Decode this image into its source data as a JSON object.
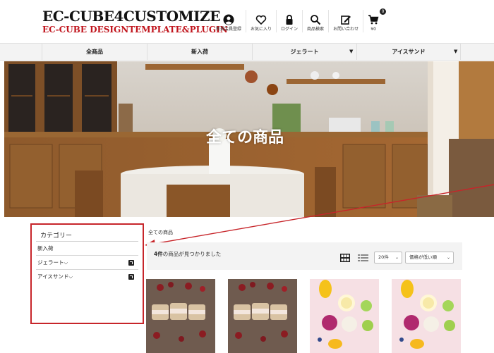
{
  "header": {
    "logo_line1": "EC-CUBE4CUSTOMIZE",
    "logo_line2": "EC-CUBE DESIGNTEMPLATE&PLUGIN",
    "nav": [
      {
        "label": "新規会員登録",
        "icon": "user-icon"
      },
      {
        "label": "お気に入り",
        "icon": "heart-icon"
      },
      {
        "label": "ログイン",
        "icon": "lock-icon"
      },
      {
        "label": "商品検索",
        "icon": "search-icon"
      },
      {
        "label": "お問い合わせ",
        "icon": "edit-icon"
      }
    ],
    "cart": {
      "count": "0",
      "price": "¥0",
      "icon": "cart-icon"
    }
  },
  "catbar": {
    "items": [
      "全商品",
      "新入荷",
      "ジェラート",
      "アイスサンド"
    ]
  },
  "hero": {
    "title": "全ての商品"
  },
  "sidebar": {
    "title": "カテゴリー",
    "items": [
      {
        "label": "新入荷"
      },
      {
        "label": "ジェラート⌵"
      },
      {
        "label": "アイスサンド⌵"
      }
    ]
  },
  "main": {
    "breadcrumb": "全ての商品",
    "results_count_number": "4件",
    "results_count_text": "の商品が見つかりました",
    "per_page": "20件",
    "sort": "価格が低い順"
  },
  "colors": {
    "accent_red": "#c7252a",
    "bar_bg": "#f3f3f3"
  }
}
